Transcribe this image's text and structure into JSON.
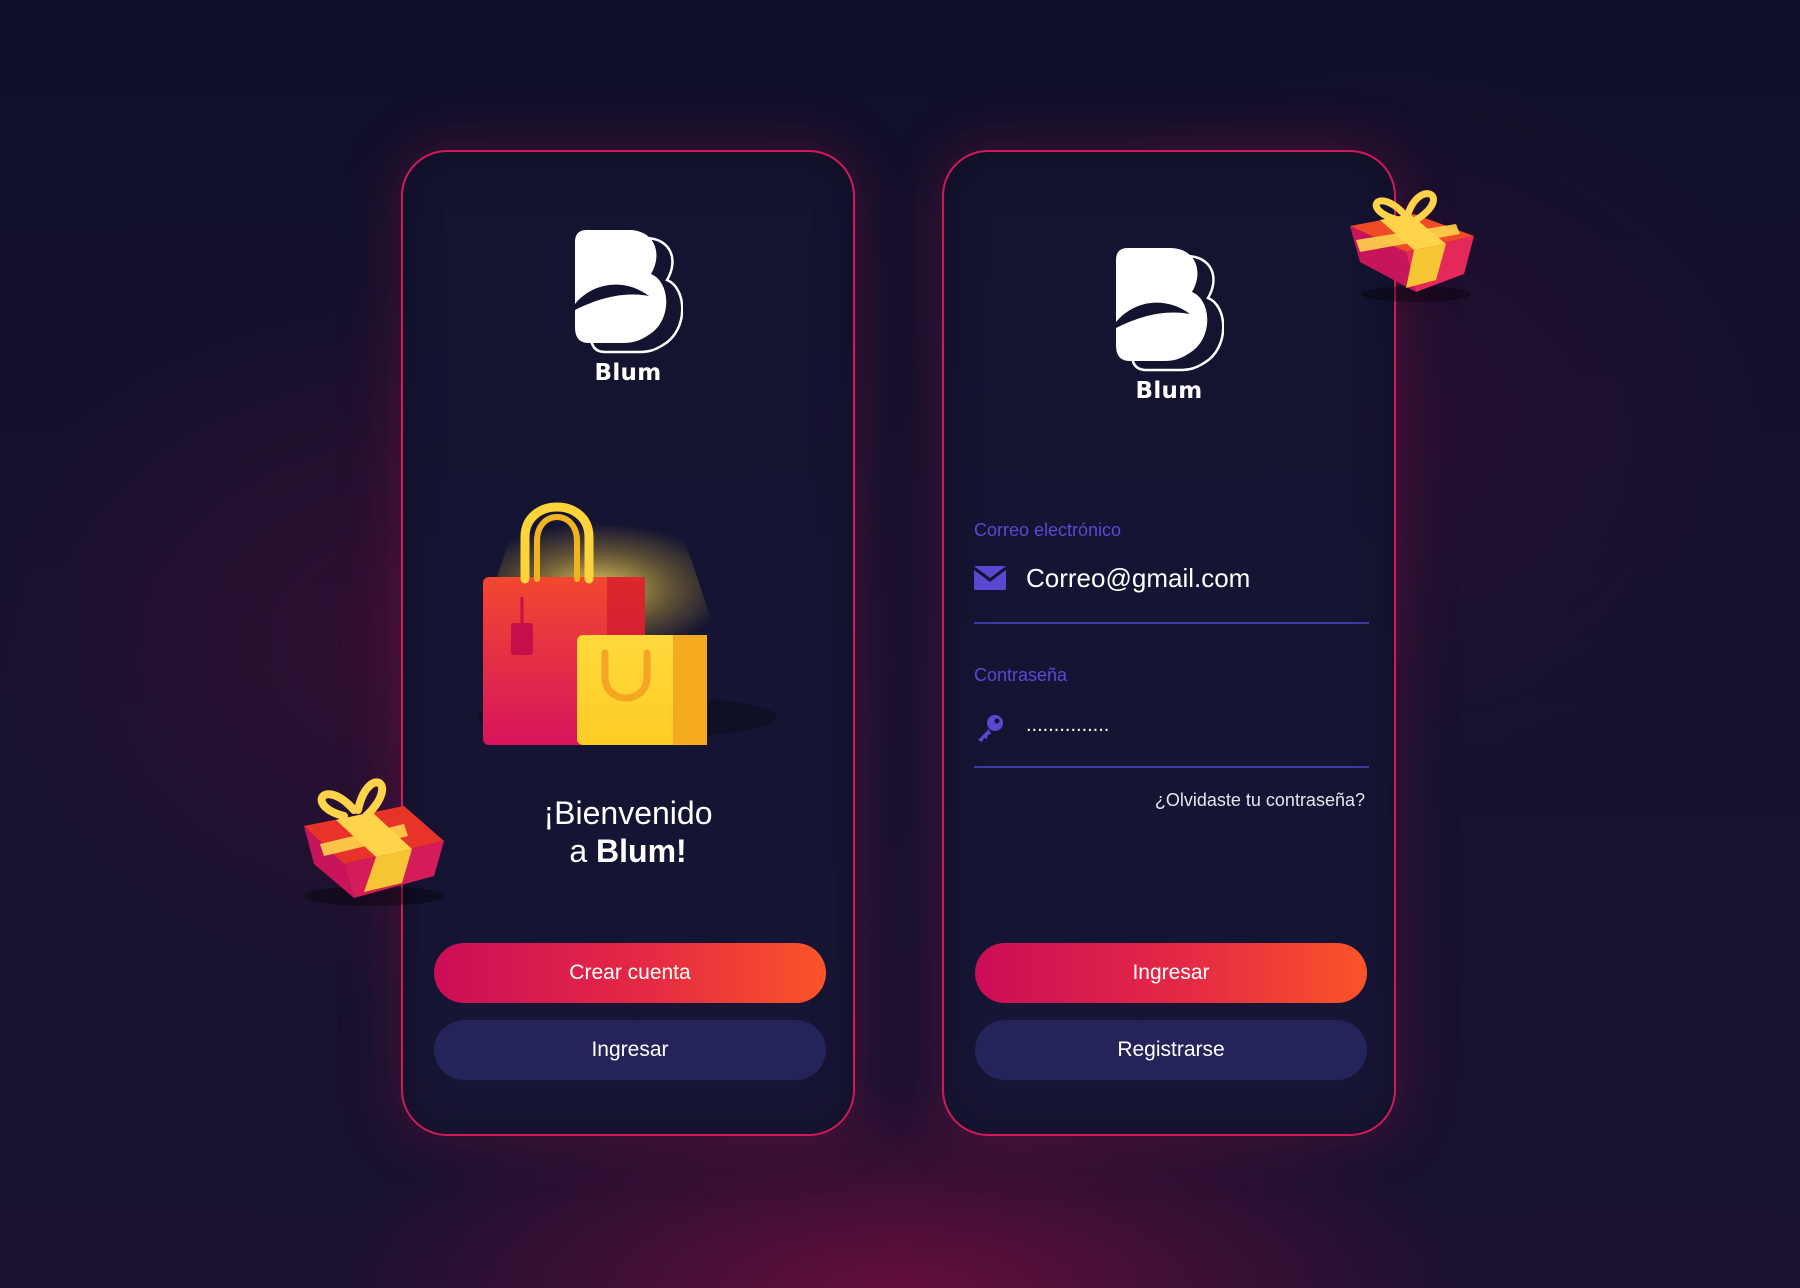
{
  "brand": {
    "name": "Blum"
  },
  "welcome_screen": {
    "heading_line1": "¡Bienvenido",
    "heading_line2_prefix": "a ",
    "heading_line2_bold": "Blum!",
    "primary_button": "Crear cuenta",
    "secondary_button": "Ingresar"
  },
  "login_screen": {
    "email_label": "Correo electrónico",
    "email_value": "Correo@gmail.com",
    "password_label": "Contraseña",
    "password_value": "...............",
    "forgot_link": "¿Olvidaste tu contraseña?",
    "primary_button": "Ingresar",
    "secondary_button": "Registrarse"
  },
  "icons": {
    "email": "envelope-icon",
    "password": "key-icon",
    "logo": "blum-logo-icon",
    "illustration": "shopping-bags-icon",
    "decoration": "gift-box-icon"
  },
  "colors": {
    "background": "#12112c",
    "card_border": "#d2195a",
    "primary_gradient_start": "#cc0d58",
    "primary_gradient_end": "#fb5428",
    "secondary_button": "#24235a",
    "field_label": "#5b48d6",
    "field_underline": "#3b3aa8"
  }
}
